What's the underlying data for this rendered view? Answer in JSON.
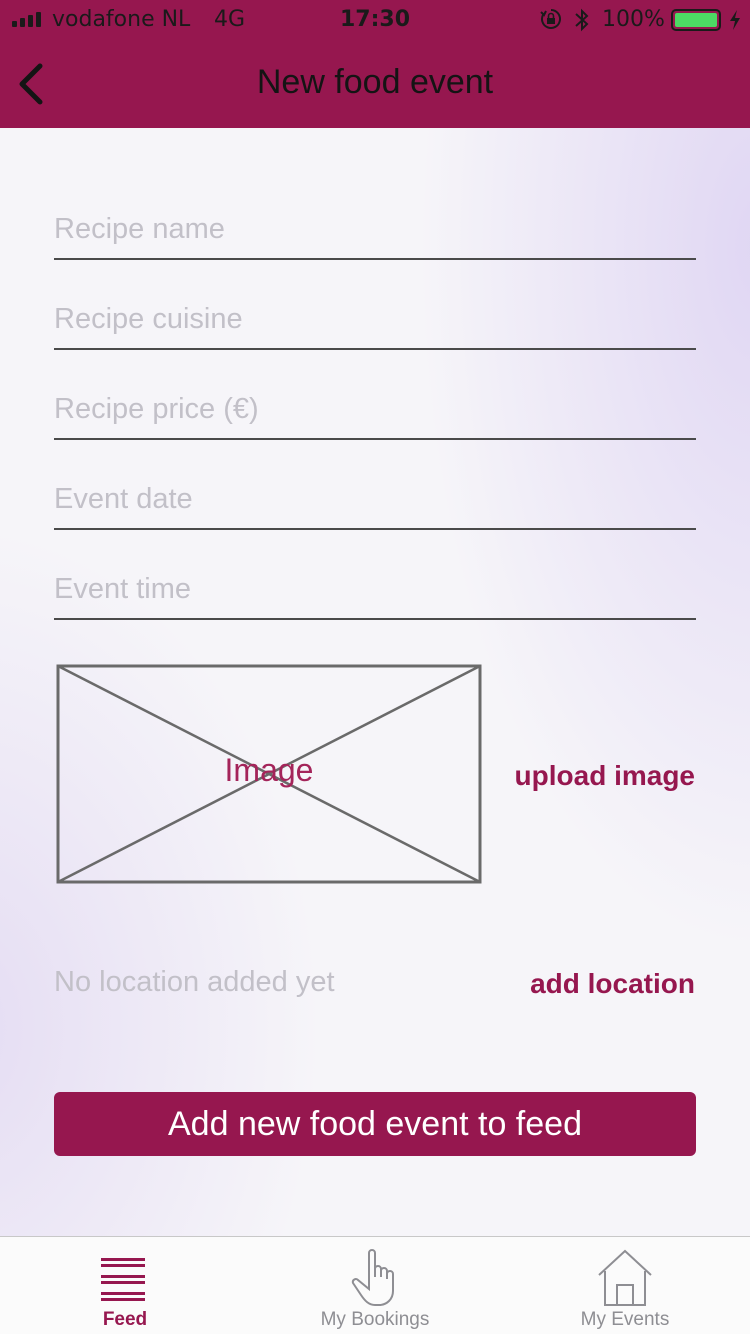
{
  "status_bar": {
    "carrier": "vodafone NL",
    "network": "4G",
    "time": "17:30",
    "battery": "100%"
  },
  "nav": {
    "title": "New food event"
  },
  "form": {
    "recipe_name_placeholder": "Recipe name",
    "recipe_cuisine_placeholder": "Recipe cuisine",
    "recipe_price_placeholder": "Recipe price (€)",
    "event_date_placeholder": "Event date",
    "event_time_placeholder": "Event time",
    "image_placeholder_label": "Image",
    "upload_image_label": "upload image",
    "location_status": "No location added yet",
    "add_location_label": "add location",
    "submit_label": "Add new food event to feed"
  },
  "tabs": [
    {
      "label": "Feed",
      "icon": "menu-icon",
      "active": true
    },
    {
      "label": "My Bookings",
      "icon": "hand-pointer-icon",
      "active": false
    },
    {
      "label": "My Events",
      "icon": "house-icon",
      "active": false
    }
  ],
  "colors": {
    "brand": "#96174f",
    "placeholder": "#c2c0c8",
    "battery": "#4cd964"
  }
}
